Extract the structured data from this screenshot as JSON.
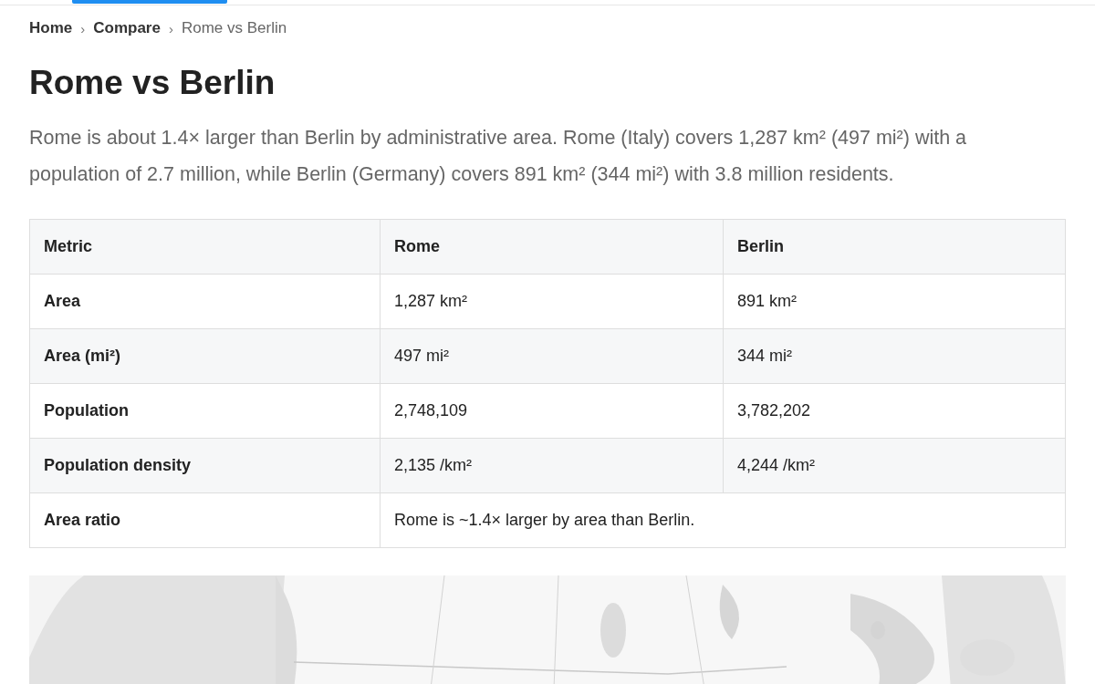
{
  "breadcrumb": [
    {
      "label": "Home",
      "current": false
    },
    {
      "label": "Compare",
      "current": false
    },
    {
      "label": "Rome vs Berlin",
      "current": true
    }
  ],
  "breadcrumb_separator": "›",
  "title": "Rome vs Berlin",
  "summary": "Rome is about 1.4× larger than Berlin by administrative area. Rome (Italy) covers 1,287 km² (497 mi²) with a population of 2.7 million, while Berlin (Germany) covers 891 km² (344 mi²) with 3.8 million residents.",
  "table": {
    "columns": [
      "Metric",
      "Rome",
      "Berlin"
    ],
    "rows": [
      {
        "kind": "pair",
        "cells": [
          "Area",
          "1,287 km²",
          "891 km²"
        ]
      },
      {
        "kind": "pair",
        "cells": [
          "Area (mi²)",
          "497 mi²",
          "344 mi²"
        ]
      },
      {
        "kind": "pair",
        "cells": [
          "Population",
          "2,748,109",
          "3,782,202"
        ]
      },
      {
        "kind": "pair",
        "cells": [
          "Population density",
          "2,135 /km²",
          "4,244 /km²"
        ]
      },
      {
        "kind": "span",
        "cells": [
          "Area ratio",
          {
            "text": "Rome is ~1.4× larger by area than Berlin.",
            "colspan": 2
          }
        ]
      }
    ]
  }
}
